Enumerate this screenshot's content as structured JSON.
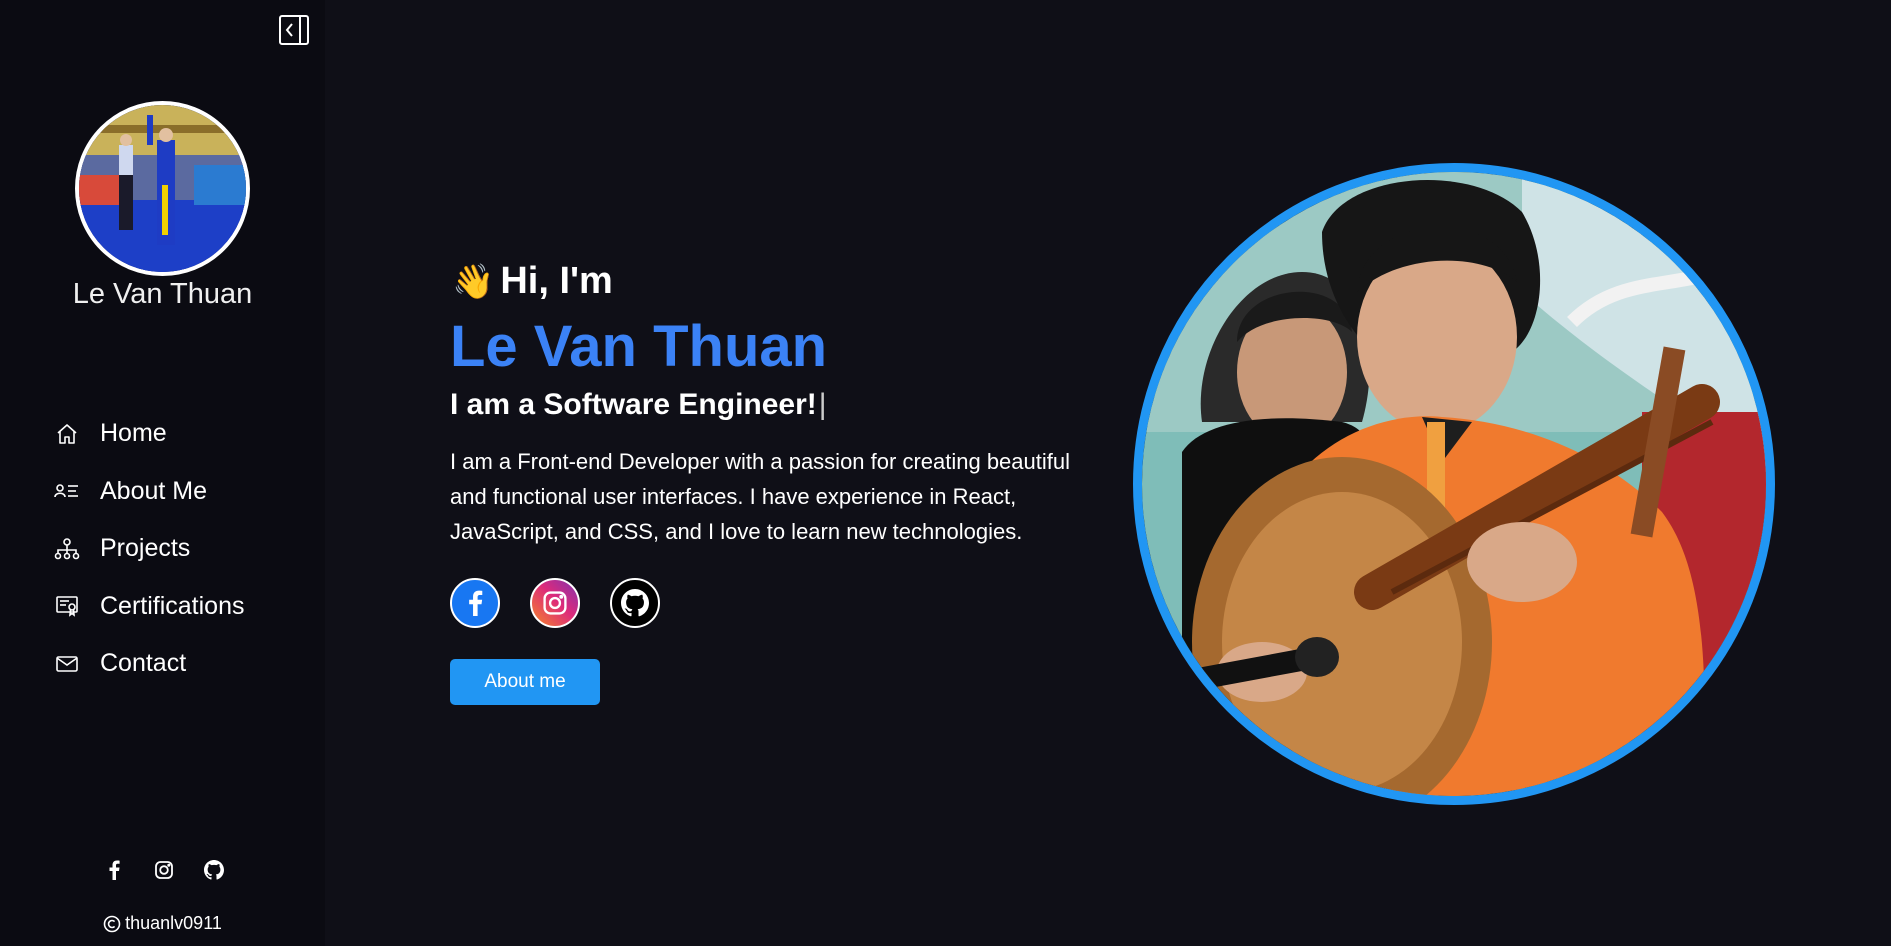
{
  "sidebar": {
    "name": "Le Van Thuan",
    "nav": [
      {
        "label": "Home",
        "icon": "home-icon"
      },
      {
        "label": "About Me",
        "icon": "profile-card-icon"
      },
      {
        "label": "Projects",
        "icon": "hierarchy-icon"
      },
      {
        "label": "Certifications",
        "icon": "certificate-icon"
      },
      {
        "label": "Contact",
        "icon": "mail-icon"
      }
    ],
    "socials": [
      "facebook-icon",
      "instagram-icon",
      "github-icon"
    ],
    "copyright": "thuanlv0911"
  },
  "hero": {
    "greeting": "Hi, I'm",
    "wave_emoji": "👋",
    "name": "Le Van Thuan",
    "role": "I am a Software Engineer!",
    "cursor": "|",
    "description": "I am a Front-end Developer with a passion for creating beautiful and functional user interfaces. I have experience in React, JavaScript, and CSS, and I love to learn new technologies.",
    "cta_label": "About me"
  },
  "colors": {
    "accent": "#3b82f6",
    "button": "#2196f3",
    "background": "#0f0f17",
    "sidebar": "#0b0b12"
  }
}
